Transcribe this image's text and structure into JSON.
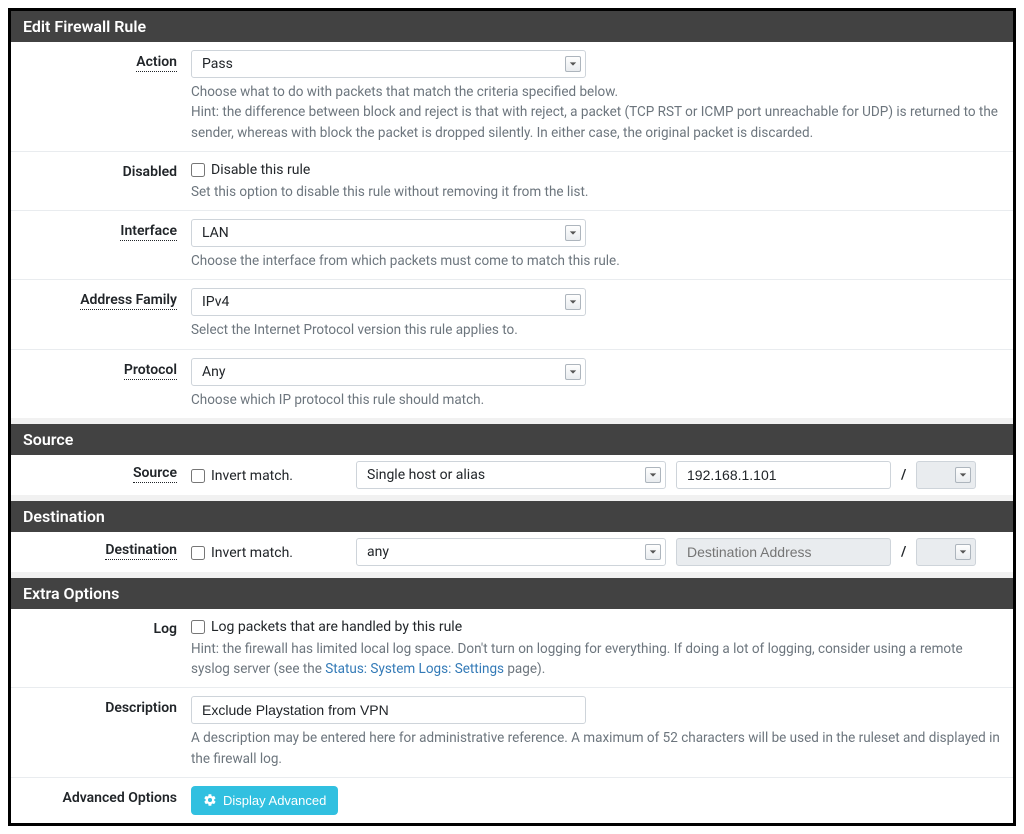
{
  "headers": {
    "edit": "Edit Firewall Rule",
    "source": "Source",
    "destination": "Destination",
    "extra": "Extra Options"
  },
  "action": {
    "label": "Action",
    "value": "Pass",
    "hint": "Choose what to do with packets that match the criteria specified below.\nHint: the difference between block and reject is that with reject, a packet (TCP RST or ICMP port unreachable for UDP) is returned to the sender, whereas with block the packet is dropped silently. In either case, the original packet is discarded."
  },
  "disabled": {
    "label": "Disabled",
    "checkbox_label": "Disable this rule",
    "hint": "Set this option to disable this rule without removing it from the list."
  },
  "interface": {
    "label": "Interface",
    "value": "LAN",
    "hint": "Choose the interface from which packets must come to match this rule."
  },
  "address_family": {
    "label": "Address Family",
    "value": "IPv4",
    "hint": "Select the Internet Protocol version this rule applies to."
  },
  "protocol": {
    "label": "Protocol",
    "value": "Any",
    "hint": "Choose which IP protocol this rule should match."
  },
  "source": {
    "label": "Source",
    "invert_label": "Invert match.",
    "type_value": "Single host or alias",
    "address_value": "192.168.1.101",
    "mask_value": "",
    "slash": "/"
  },
  "destination": {
    "label": "Destination",
    "invert_label": "Invert match.",
    "type_value": "any",
    "address_placeholder": "Destination Address",
    "mask_value": "",
    "slash": "/"
  },
  "log": {
    "label": "Log",
    "checkbox_label": "Log packets that are handled by this rule",
    "hint_prefix": "Hint: the firewall has limited local log space. Don't turn on logging for everything. If doing a lot of logging, consider using a remote syslog server (see the ",
    "hint_link": "Status: System Logs: Settings",
    "hint_suffix": " page)."
  },
  "description": {
    "label": "Description",
    "value": "Exclude Playstation from VPN",
    "hint": "A description may be entered here for administrative reference. A maximum of 52 characters will be used in the ruleset and displayed in the firewall log."
  },
  "advanced": {
    "label": "Advanced Options",
    "button": "Display Advanced"
  }
}
